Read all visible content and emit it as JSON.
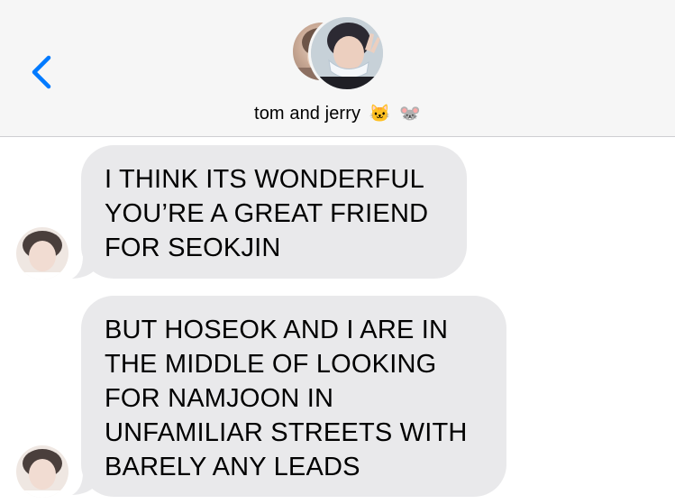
{
  "header": {
    "back_icon": "chevron-left-icon",
    "group_name": "tom and jerry",
    "emojis": [
      "🐱",
      "🐭"
    ],
    "accent_color": "#007aff"
  },
  "messages": [
    {
      "sender": "incoming",
      "lines": [
        "I THINK ITS WONDERFUL",
        "YOU’RE A GREAT FRIEND",
        "FOR SEOKJIN"
      ]
    },
    {
      "sender": "incoming",
      "lines": [
        "BUT HOSEOK AND I ARE IN",
        "THE MIDDLE OF LOOKING",
        "FOR NAMJOON IN",
        "UNFAMILIAR STREETS WITH",
        "BARELY ANY LEADS"
      ]
    }
  ],
  "colors": {
    "bubble_incoming": "#e9e9eb",
    "header_bg": "#f6f6f6",
    "text": "#000000"
  }
}
